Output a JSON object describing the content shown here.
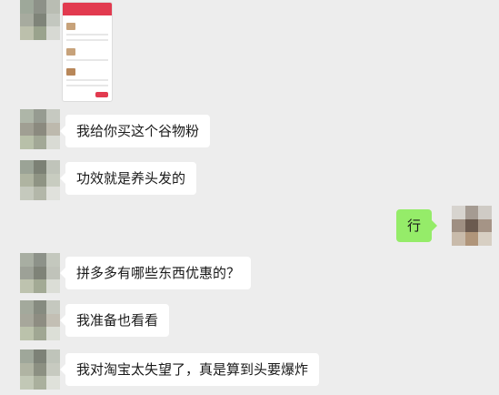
{
  "chat": {
    "messages": [
      {
        "side": "left",
        "type": "image",
        "text": ""
      },
      {
        "side": "left",
        "type": "text",
        "text": "我给你买这个谷物粉"
      },
      {
        "side": "left",
        "type": "text",
        "text": "功效就是养头发的"
      },
      {
        "side": "right",
        "type": "text",
        "text": "行"
      },
      {
        "side": "left",
        "type": "text",
        "text": "拼多多有哪些东西优惠的？"
      },
      {
        "side": "left",
        "type": "text",
        "text": "我准备也看看"
      },
      {
        "side": "left",
        "type": "text",
        "text": "我对淘宝太失望了，真是算到头要爆炸"
      }
    ]
  },
  "colors": {
    "background": "#ededed",
    "bubble_left": "#ffffff",
    "bubble_right": "#95ec69",
    "accent": "#e23a4f"
  }
}
